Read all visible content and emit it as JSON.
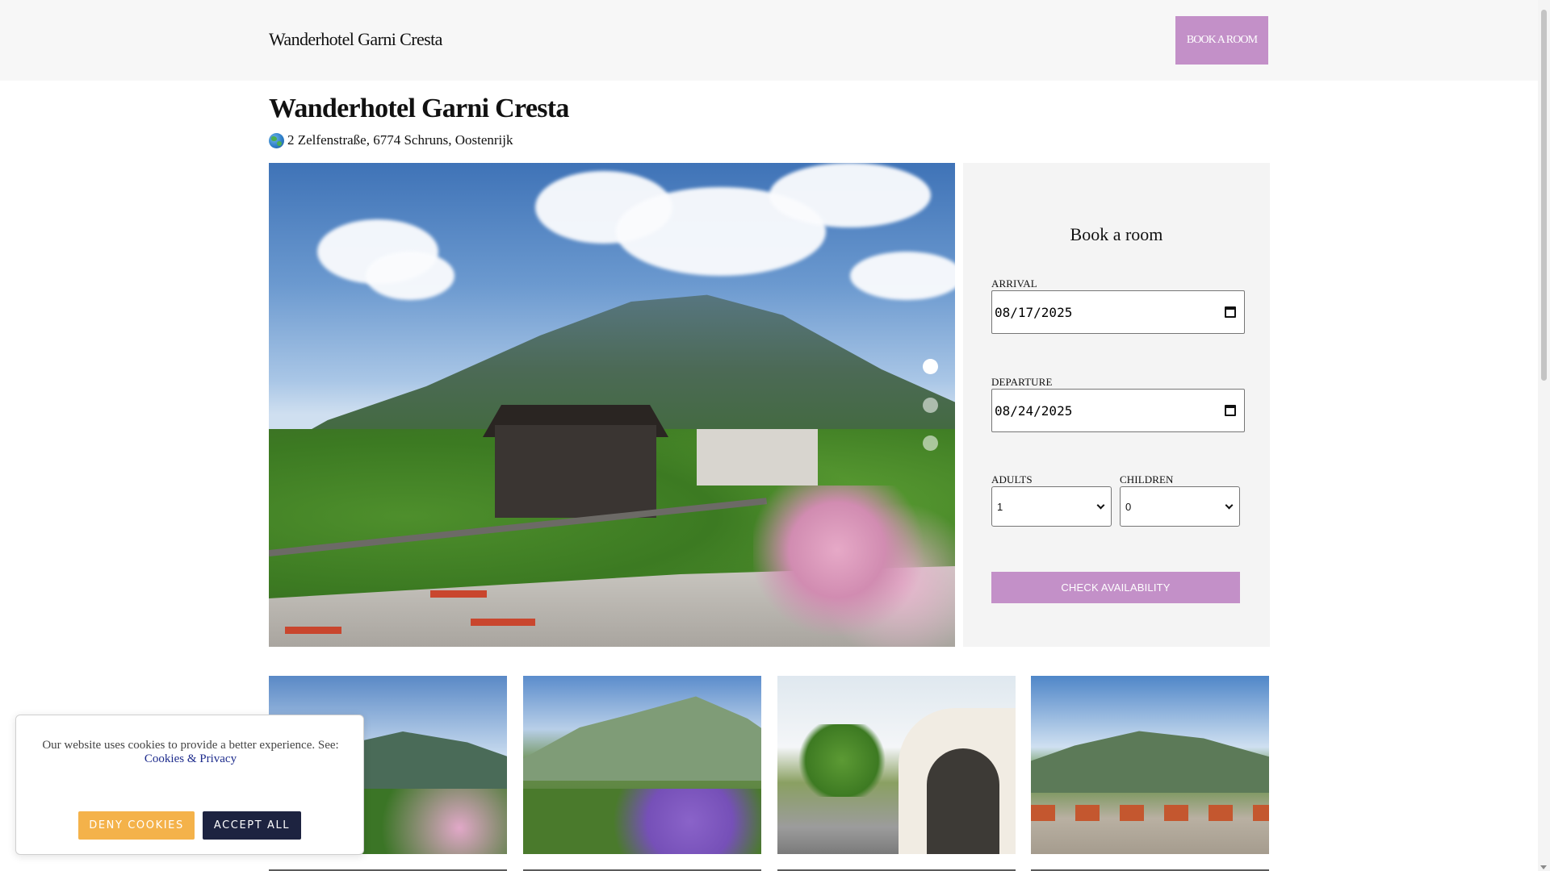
{
  "header": {
    "brand": "Wanderhotel Garni Cresta",
    "book_button": "BOOK A ROOM"
  },
  "hotel": {
    "title": "Wanderhotel Garni Cresta",
    "address": "2 Zelfenstraße, 6774 Schruns, Oostenrijk",
    "address_icon": "globe-icon"
  },
  "gallery": {
    "slide_count": 3,
    "active_slide": 1,
    "thumbnails": [
      "terrace-mountain-view",
      "valley-flowers-view",
      "hotel-entrance-arch",
      "terrace-tables-view"
    ]
  },
  "booking": {
    "heading": "Book a room",
    "arrival_label": "ARRIVAL",
    "arrival_value": "08/17/2025",
    "departure_label": "DEPARTURE",
    "departure_value": "08/24/2025",
    "adults_label": "ADULTS",
    "adults_value": "1",
    "children_label": "CHILDREN",
    "children_value": "0",
    "check_button": "CHECK AVAILABILITY"
  },
  "cookie_banner": {
    "text": "Our website uses cookies to provide a better experience. See:",
    "link": "Cookies & Privacy",
    "deny_button": "DENY COOKIES",
    "accept_button": "ACCEPT ALL"
  },
  "colors": {
    "accent": "#c390c8",
    "deny": "#f4b24a",
    "accept": "#1d2340",
    "header_bg": "#f7f7f7",
    "panel_bg": "#f4f4f4"
  }
}
